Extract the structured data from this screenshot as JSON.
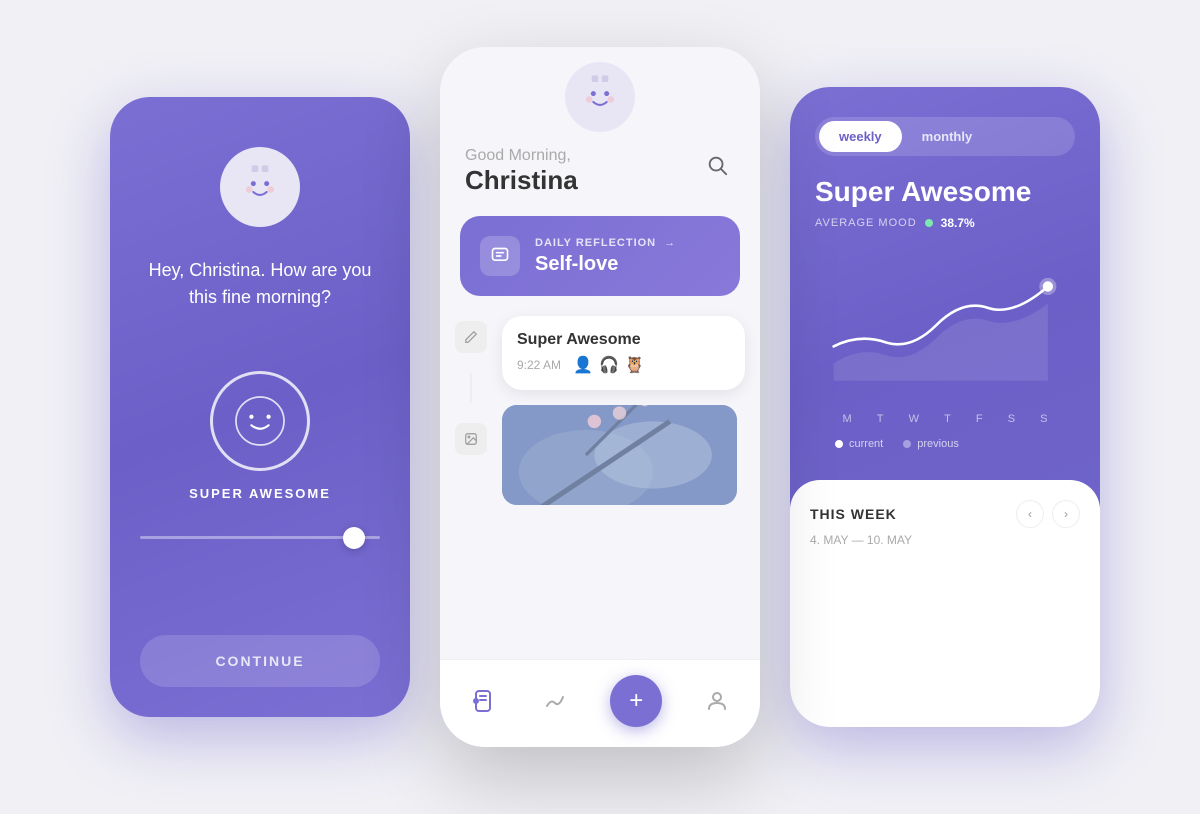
{
  "leftPhone": {
    "greeting": "Hey, Christina. How are you this fine morning?",
    "moodLabel": "SUPER AWESOME",
    "continueBtn": "CONTINUE"
  },
  "centerPhone": {
    "greetingSmall": "Good Morning,",
    "name": "Christina",
    "dailyReflection": {
      "label": "DAILY REFLECTION",
      "value": "Self-love"
    },
    "entry": {
      "title": "Super Awesome",
      "time": "9:22 AM"
    },
    "nav": {
      "addBtn": "+"
    }
  },
  "rightPhone": {
    "toggleWeekly": "weekly",
    "toggleMonthly": "monthly",
    "moodTitle": "Super Awesome",
    "avgMoodLabel": "AVERAGE MOOD",
    "avgMoodValue": "38.7%",
    "thisWeek": {
      "title": "THIS WEEK",
      "dateRange": "4. MAY — 10. MAY"
    },
    "days": [
      "M",
      "T",
      "W",
      "T",
      "F",
      "S",
      "S"
    ],
    "legend": {
      "current": "current",
      "previous": "previous"
    }
  }
}
